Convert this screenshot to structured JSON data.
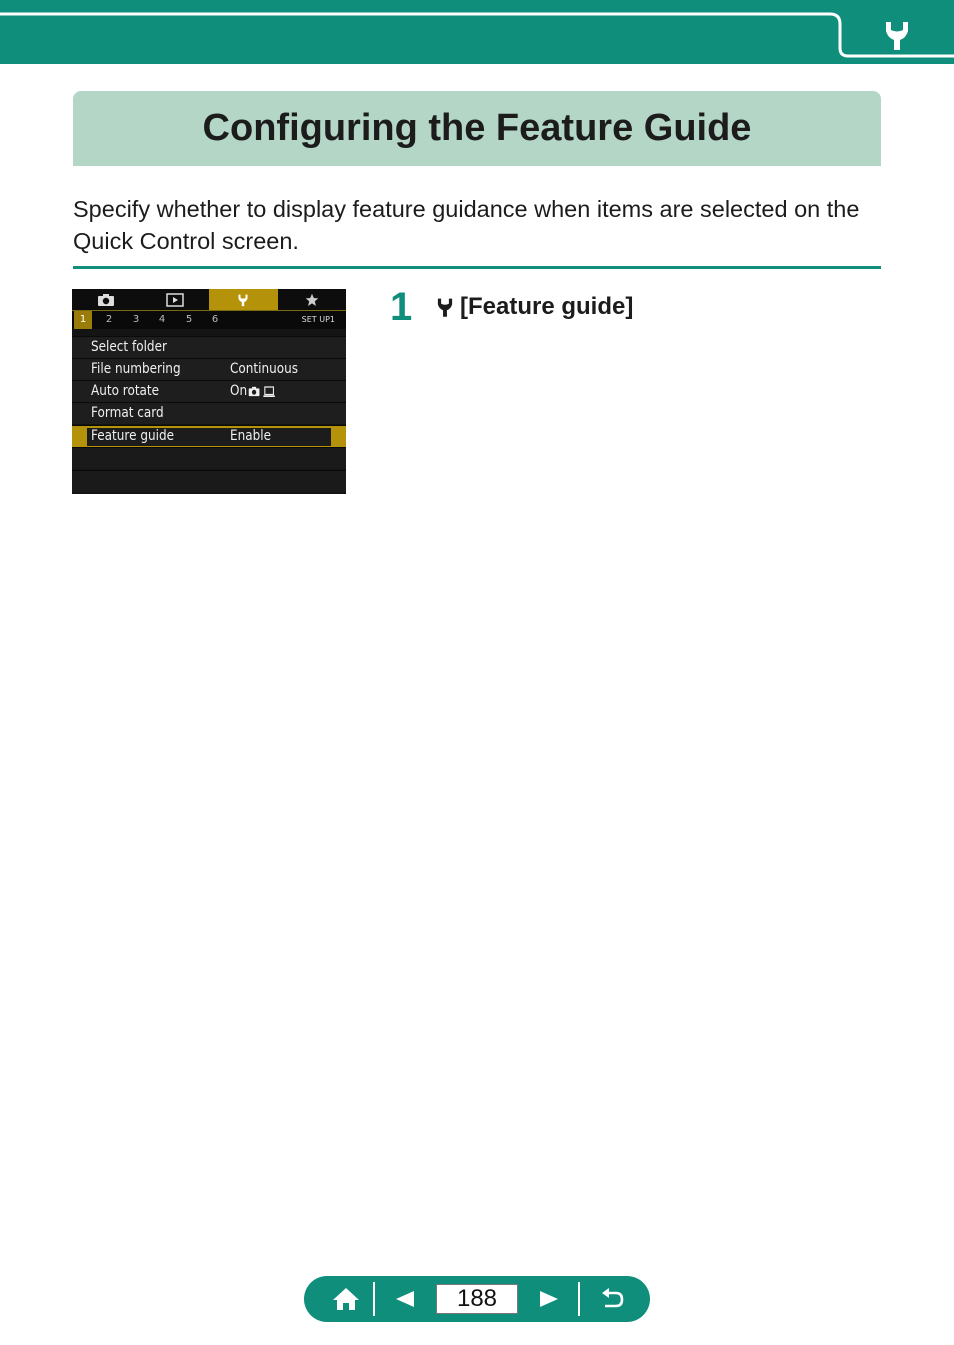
{
  "colors": {
    "accent": "#0f8e7c",
    "title_bg": "#b3d6c7",
    "camera_highlight": "#b4930a"
  },
  "header": {
    "section_icon": "wrench-icon"
  },
  "page_title": "Configuring the Feature Guide",
  "intro_text": "Specify whether to display feature guidance when items are selected on the Quick Control screen.",
  "camera_screen": {
    "tab_icons": [
      "camera-icon",
      "playback-icon",
      "wrench-icon",
      "star-icon"
    ],
    "active_tab": 2,
    "sub_tabs": [
      "1",
      "2",
      "3",
      "4",
      "5",
      "6"
    ],
    "active_sub_tab": 0,
    "page_label": "SET UP1",
    "items": [
      {
        "label": "Select folder",
        "value": ""
      },
      {
        "label": "File numbering",
        "value": "Continuous"
      },
      {
        "label": "Auto rotate",
        "value": "On"
      },
      {
        "label": "Format card",
        "value": ""
      },
      {
        "label": "Feature guide",
        "value": "Enable"
      }
    ],
    "selected_item": 4
  },
  "step": {
    "number": "1",
    "text": "[Feature guide]"
  },
  "nav": {
    "page_number": "188"
  }
}
